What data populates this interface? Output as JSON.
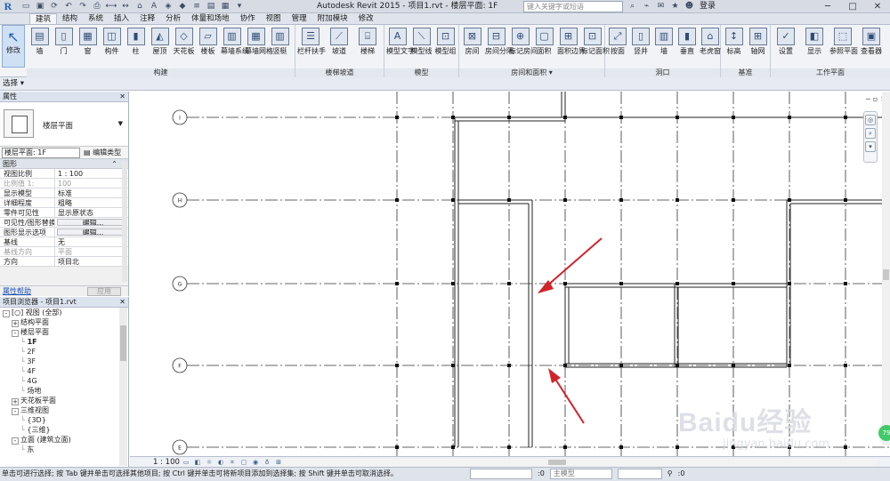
{
  "titlebar": {
    "app_title": "Autodesk Revit 2015 -   项目1.rvt - 楼层平面: 1F",
    "search_placeholder": "键入关键字或短语",
    "login": "登录",
    "min": "─",
    "max": "□",
    "close": "✕"
  },
  "ribbon_tabs": [
    "建筑",
    "结构",
    "系统",
    "插入",
    "注释",
    "分析",
    "体量和场地",
    "协作",
    "视图",
    "管理",
    "附加模块",
    "修改"
  ],
  "ribbon": {
    "modify_label": "修改",
    "build_buttons": [
      "墙",
      "门",
      "窗",
      "构件",
      "柱",
      "屋顶",
      "天花板",
      "楼板",
      "幕墙系统",
      "幕墙网格",
      "竖梃"
    ],
    "build_label": "构建",
    "circ_buttons": [
      "栏杆扶手",
      "坡道",
      "楼梯"
    ],
    "circ_label": "楼梯坡道",
    "model_buttons": [
      "模型文字",
      "模型线",
      "模型组"
    ],
    "model_label": "模型",
    "room_buttons": [
      "房间",
      "房间分隔",
      "标记房间",
      "面积",
      "面积边界",
      "标记面积"
    ],
    "room_label": "房间和面积 ▾",
    "opening_buttons": [
      "按面",
      "竖井",
      "墙",
      "垂直",
      "老虎窗"
    ],
    "opening_label": "洞口",
    "datum_buttons": [
      "标高",
      "轴网"
    ],
    "datum_label": "基准",
    "wp_buttons": [
      "设置",
      "显示",
      "参照平面",
      "查看器"
    ],
    "wp_label": "工作平面"
  },
  "options_row": {
    "select": "选择 ▾"
  },
  "properties": {
    "title": "属性",
    "type_name": "楼层平面",
    "instance_selector": "楼层平面: 1F",
    "edit_type": "编辑类型",
    "category": "图形",
    "rows": [
      {
        "k": "视图比例",
        "v": "1 : 100"
      },
      {
        "k": "比例值 1:",
        "v": "100"
      },
      {
        "k": "显示模型",
        "v": "标准"
      },
      {
        "k": "详细程度",
        "v": "粗略"
      },
      {
        "k": "零件可见性",
        "v": "显示原状态"
      },
      {
        "k": "可见性/图形替换",
        "v": "编辑..."
      },
      {
        "k": "图形显示选项",
        "v": "编辑..."
      },
      {
        "k": "基线",
        "v": "无"
      },
      {
        "k": "基线方向",
        "v": "平面"
      },
      {
        "k": "方向",
        "v": "项目北"
      }
    ],
    "help": "属性帮助",
    "apply": "应用"
  },
  "browser": {
    "title": "项目浏览器 - 项目1.rvt",
    "items": [
      {
        "indent": 0,
        "tw": "-",
        "label": "[○] 视图 (全部)",
        "bold": false
      },
      {
        "indent": 1,
        "tw": "+",
        "label": "结构平面",
        "bold": false
      },
      {
        "indent": 1,
        "tw": "-",
        "label": "楼层平面",
        "bold": false
      },
      {
        "indent": 2,
        "tw": "",
        "label": "1F",
        "bold": true
      },
      {
        "indent": 2,
        "tw": "",
        "label": "2F",
        "bold": false
      },
      {
        "indent": 2,
        "tw": "",
        "label": "3F",
        "bold": false
      },
      {
        "indent": 2,
        "tw": "",
        "label": "4F",
        "bold": false
      },
      {
        "indent": 2,
        "tw": "",
        "label": "4G",
        "bold": false
      },
      {
        "indent": 2,
        "tw": "",
        "label": "场地",
        "bold": false
      },
      {
        "indent": 1,
        "tw": "+",
        "label": "天花板平面",
        "bold": false
      },
      {
        "indent": 1,
        "tw": "-",
        "label": "三维视图",
        "bold": false
      },
      {
        "indent": 2,
        "tw": "",
        "label": "{3D}",
        "bold": false
      },
      {
        "indent": 2,
        "tw": "",
        "label": "{三维}",
        "bold": false
      },
      {
        "indent": 1,
        "tw": "-",
        "label": "立面 (建筑立面)",
        "bold": false
      },
      {
        "indent": 2,
        "tw": "",
        "label": "东",
        "bold": false
      }
    ]
  },
  "grid_labels": [
    "I",
    "H",
    "G",
    "F",
    "E"
  ],
  "view_bar": {
    "scale": "1 : 100"
  },
  "watermark": {
    "big": "Baidu经验",
    "small": "jingyan.baidu.com",
    "badge": "79"
  },
  "status_bar": {
    "text": "单击可进行选择; 按 Tab 键并单击可选择其他项目; 按 Ctrl 键并单击可将新项目添加到选择集; 按 Shift 键并单击可取消选择。",
    "zero1": ":0",
    "model": "主模型",
    "zero2": ":0"
  }
}
